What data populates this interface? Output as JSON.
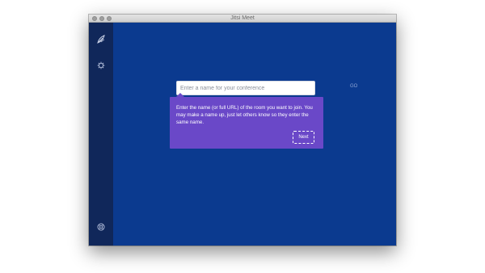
{
  "window": {
    "title": "Jitsi Meet"
  },
  "sidebar": {
    "items": [
      {
        "icon": "jitsi-logo-icon"
      },
      {
        "icon": "gear-icon"
      },
      {
        "icon": "help-icon"
      }
    ]
  },
  "main": {
    "room_input": {
      "placeholder": "Enter a name for your conference",
      "value": ""
    },
    "go_label": "GO",
    "onboarding": {
      "text": "Enter the name (or full URL) of the room you want to join. You may make a name up, just let others know so they enter the same name.",
      "next_label": "Next"
    }
  },
  "colors": {
    "background": "#0b3a8f",
    "sidebar": "#10275a",
    "tooltip": "#6a48c8"
  }
}
